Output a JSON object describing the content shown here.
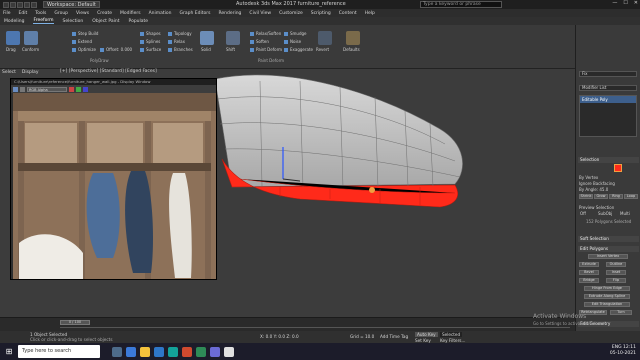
{
  "titlebar": {
    "workspace": "Workspace: Default",
    "title": "Autodesk 3ds Max 2017    furniture_reference",
    "search_placeholder": "Type a keyword or phrase",
    "win_controls": [
      "—",
      "☐",
      "✕"
    ]
  },
  "menubar": [
    "File",
    "Edit",
    "Tools",
    "Group",
    "Views",
    "Create",
    "Modifiers",
    "Animation",
    "Graph Editors",
    "Rendering",
    "Civil View",
    "Customize",
    "Scripting",
    "Content",
    "Help"
  ],
  "ribbon": {
    "tabs": [
      "Modeling",
      "Freeform",
      "Selection",
      "Object Paint",
      "Populate"
    ],
    "active_tab": "Freeform",
    "groups": {
      "left_buttons": [
        "Drag",
        "Conform",
        "Step Build",
        "Extend",
        "Optimize",
        "Offset: 0.000"
      ],
      "mid_buttons": [
        "Shapes",
        "Splines",
        "Surface",
        "Topology",
        "Relax",
        "Branches"
      ],
      "right_buttons": [
        "Solid",
        "Relax/Soften",
        "Soften",
        "Shift",
        "Paint Deform",
        "Smudge",
        "Noise",
        "Exaggerate",
        "Revert",
        "Defaults"
      ],
      "section_labels": [
        "PolyDraw",
        "Paint Deform"
      ]
    }
  },
  "viewport": {
    "label": "[+] [Perspective] [Standard] [Edged Faces]",
    "left_tabs": [
      "Select",
      "Display"
    ]
  },
  "reference_window": {
    "title": "C:\\Users\\furniture\\reference\\furniture_hanger_wall.jpg - Display Window",
    "dropdown": "RGB Alpha"
  },
  "right_panel": {
    "object_name": "Fix",
    "modifier_list": "Modifier List",
    "stack_item": "Editable Poly",
    "selection_header": "Selection",
    "by_vertex": "By Vertex",
    "ignore_backfacing": "Ignore Backfacing",
    "by_angle": "By Angle: 45.0",
    "shrink_grow": [
      "Shrink",
      "Grow",
      "Ring",
      "Loop"
    ],
    "preview_selection": "Preview Selection",
    "preview_options": [
      "Off",
      "SubObj",
      "Multi"
    ],
    "selected_info": "152 Polygons Selected",
    "soft_selection": "Soft Selection",
    "edit_polygons": "Edit Polygons",
    "insert_vertex": "Insert Vertex",
    "edit_poly_buttons": [
      "Extrude",
      "Outline",
      "Bevel",
      "Inset",
      "Bridge",
      "Flip"
    ],
    "hinge": "Hinge From Edge",
    "extrude_spline": "Extrude Along Spline",
    "edit_triangulation": "Edit Triangulation",
    "retriangulate": "Retriangulate",
    "turn": "Turn",
    "edit_geometry": "Edit Geometry"
  },
  "timeline": {
    "frame": "0 / 100"
  },
  "statusbar": {
    "selection": "1 Object Selected",
    "hint": "Click or click-and-drag to select objects",
    "coords": "X: 0.0  Y: 0.0  Z: 0.0",
    "grid": "Grid = 10.0",
    "addtime": "Add Time Tag",
    "autokey": "Auto Key",
    "selected": "Selected",
    "setkey": "Set Key",
    "keyfilters": "Key Filters..."
  },
  "activation": {
    "line1": "Activate Windows",
    "line2": "Go to Settings to activate Windows."
  },
  "taskbar": {
    "search_text": "Type here to search",
    "tray_lang": "ENG",
    "tray_time": "12:11",
    "tray_date": "05-10-2021"
  },
  "colors": {
    "accent_blue": "#5b8ec9",
    "selection_red": "#ff2a1a",
    "viewport_bg": "#3c3c3c"
  }
}
